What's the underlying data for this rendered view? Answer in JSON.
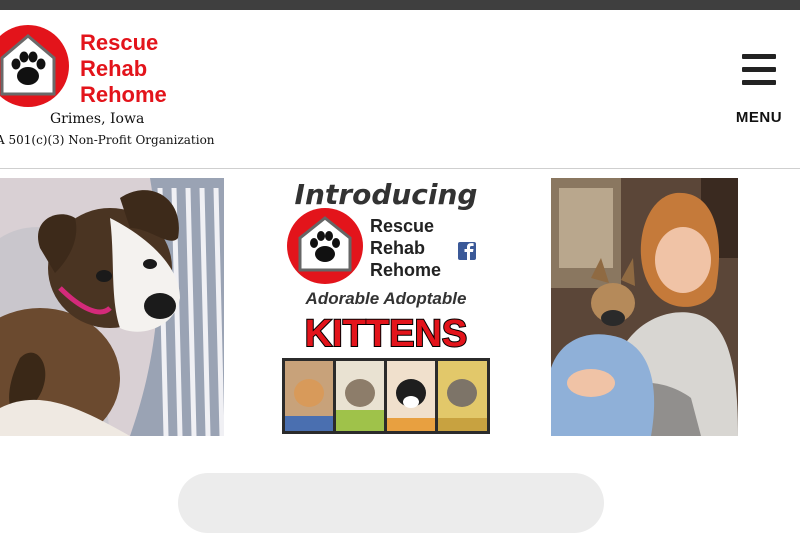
{
  "header": {
    "brand_line1": "Rescue",
    "brand_line2": "Rehab",
    "brand_line3": "Rehome",
    "location": "Grimes, Iowa",
    "organization": "A 501(c)(3) Non-Profit Organization",
    "menu_label": "MENU",
    "menu_icon": "hamburger-menu-icon",
    "logo_icon": "paw-house-icon"
  },
  "promo": {
    "title": "Introducing",
    "brand_line1": "Rescue",
    "brand_line2": "Rehab",
    "brand_line3": "Rehome",
    "subtitle": "Adorable Adoptable",
    "headline": "KITTENS",
    "social_icon": "facebook-icon"
  },
  "colors": {
    "brand_red": "#e3141b",
    "top_bar": "#3f3f3f",
    "facebook_blue": "#3b5998"
  }
}
